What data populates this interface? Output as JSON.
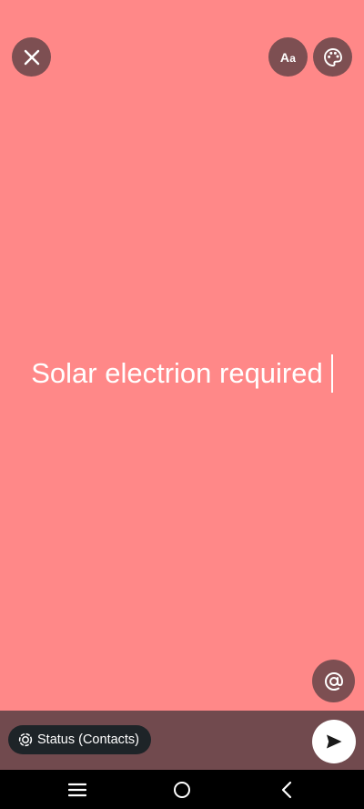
{
  "status_text": "Solar electrion required",
  "toolbar": {
    "font_label_big": "A",
    "font_label_small": "a"
  },
  "audience": {
    "label": "Status (Contacts)"
  },
  "colors": {
    "background": "#ff8888",
    "bottom_bar": "#714a4e",
    "button_fill": "#7d4f52",
    "pill_fill": "#1e2428"
  },
  "icons": {
    "close": "close-icon",
    "font": "font-style-icon",
    "palette": "palette-icon",
    "mention": "at-sign-icon",
    "audience": "status-icon",
    "send": "send-icon",
    "nav_menu": "recent-apps-icon",
    "nav_home": "home-icon",
    "nav_back": "back-icon"
  }
}
